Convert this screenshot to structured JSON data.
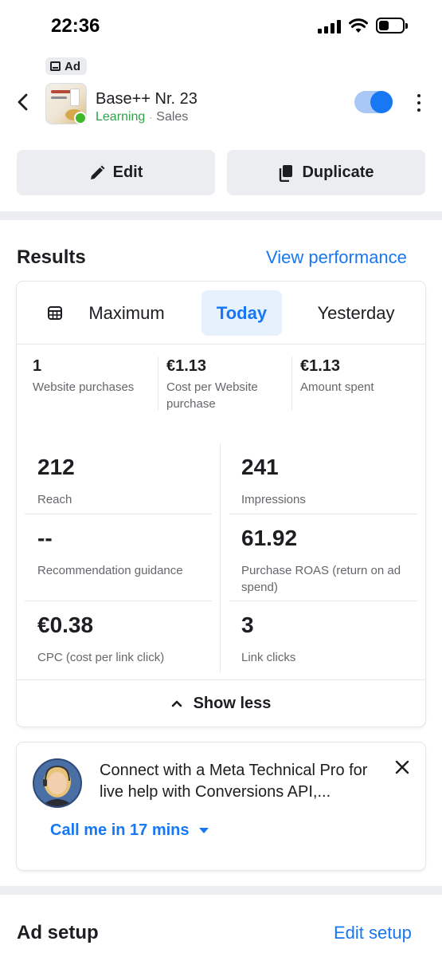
{
  "status_bar": {
    "time": "22:36"
  },
  "ad_badge": {
    "label": "Ad",
    "icon": "ad-icon"
  },
  "header": {
    "title": "Base++ Nr. 23",
    "status": "Learning",
    "separator": "·",
    "objective": "Sales",
    "toggle_on": true
  },
  "actions": {
    "edit_label": "Edit",
    "duplicate_label": "Duplicate"
  },
  "results": {
    "title": "Results",
    "link": "View performance",
    "tabs": [
      {
        "label": "Maximum",
        "selected": false
      },
      {
        "label": "Today",
        "selected": true
      },
      {
        "label": "Yesterday",
        "selected": false
      }
    ],
    "summary": [
      {
        "value": "1",
        "label": "Website purchases"
      },
      {
        "value": "€1.13",
        "label": "Cost per Website purchase"
      },
      {
        "value": "€1.13",
        "label": "Amount spent"
      }
    ],
    "metrics": [
      {
        "value": "212",
        "label": "Reach"
      },
      {
        "value": "241",
        "label": "Impressions"
      },
      {
        "value": "--",
        "label": "Recommendation guidance"
      },
      {
        "value": "61.92",
        "label": "Purchase ROAS (return on ad spend)"
      },
      {
        "value": "€0.38",
        "label": "CPC (cost per link click)"
      },
      {
        "value": "3",
        "label": "Link clicks"
      }
    ],
    "show_less": "Show less"
  },
  "help": {
    "text": "Connect with a Meta Technical Pro for live help with Conversions API,...",
    "call_label": "Call me in 17 mins"
  },
  "ad_setup": {
    "title": "Ad setup",
    "link": "Edit setup"
  },
  "colors": {
    "accent": "#1877f2",
    "learning": "#31a24c",
    "secondary_text": "#65676b",
    "button_bg": "#ebedf0"
  }
}
